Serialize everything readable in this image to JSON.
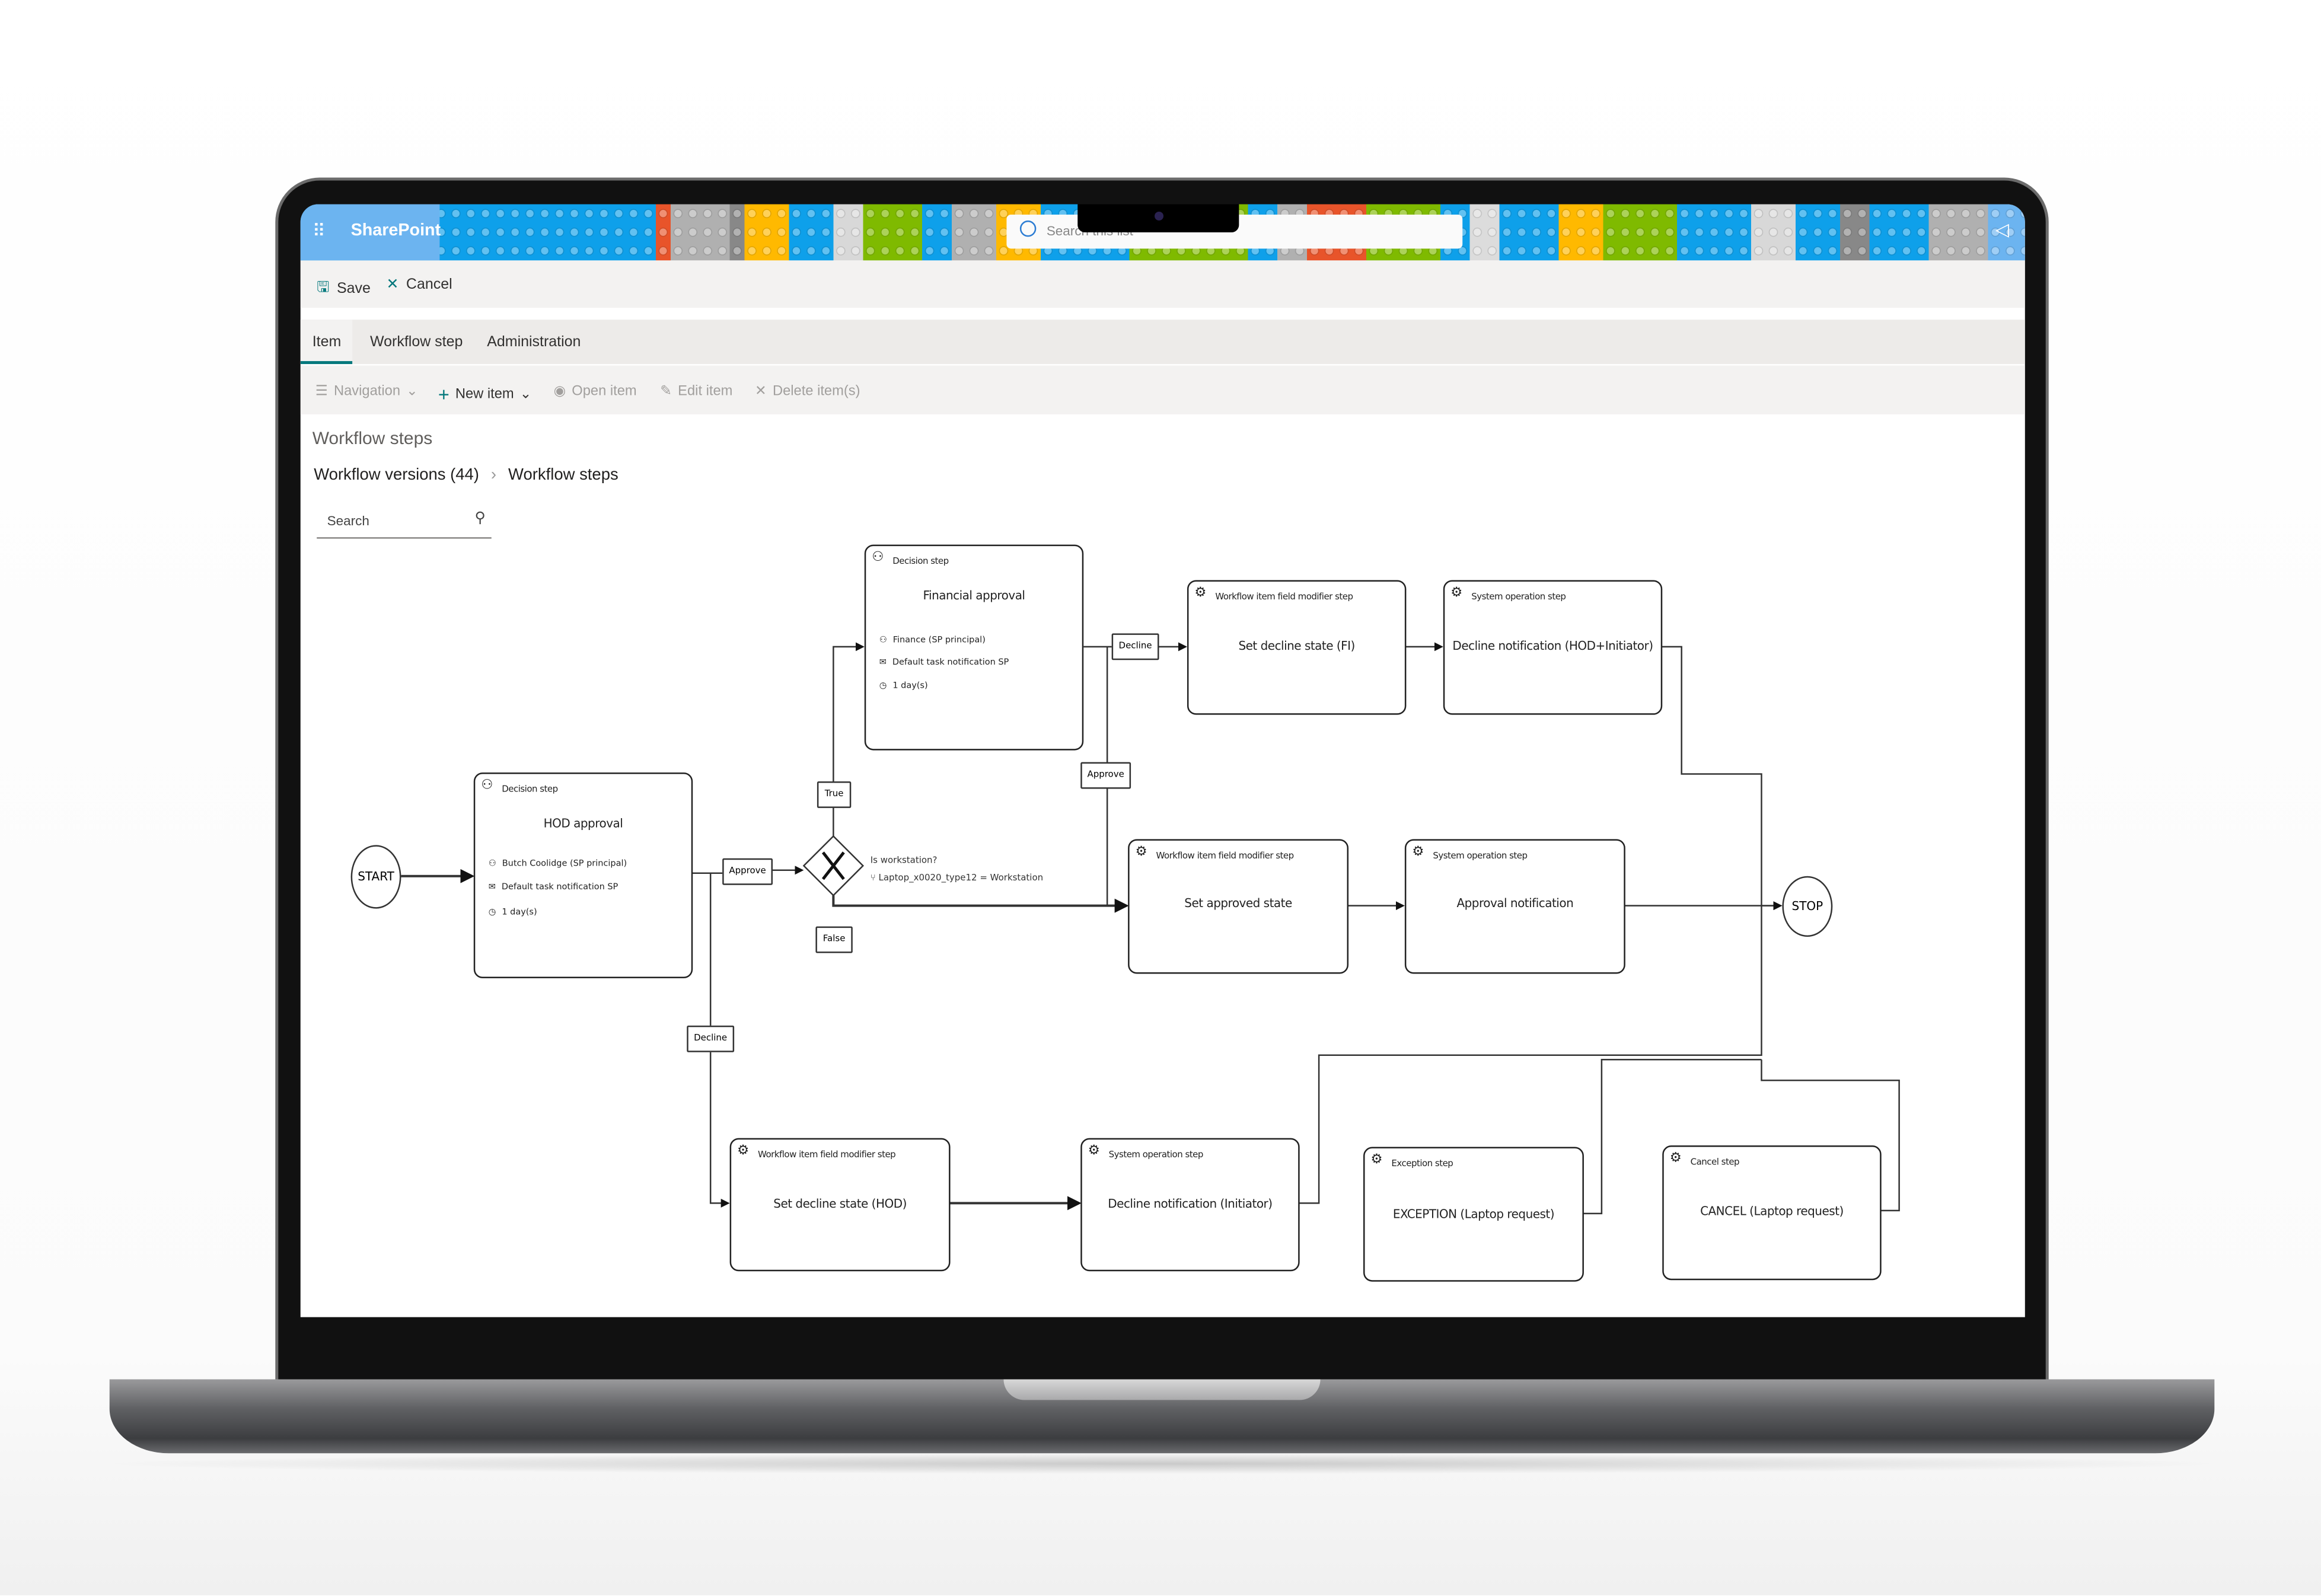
{
  "suite": {
    "brand": "SharePoint",
    "search_placeholder": "Search this list",
    "waffle_icon": "waffle-icon",
    "feedback_icon": "megaphone-icon"
  },
  "command_bar": {
    "save": "Save",
    "cancel": "Cancel"
  },
  "tabs": [
    {
      "label": "Item",
      "selected": true
    },
    {
      "label": "Workflow step"
    },
    {
      "label": "Administration"
    }
  ],
  "toolbar": {
    "navigation": "Navigation",
    "new_item": "New item",
    "open_item": "Open item",
    "edit_item": "Edit item",
    "delete_items": "Delete item(s)"
  },
  "page": {
    "title": "Workflow steps",
    "breadcrumb": [
      "Workflow versions (44)",
      "Workflow steps"
    ],
    "search_placeholder": "Search"
  },
  "colors": {
    "accent": "#03787c",
    "suite_brand": "#6cb4f0"
  },
  "diagram": {
    "start": "START",
    "stop": "STOP",
    "nodes": {
      "hod": {
        "type": "Decision step",
        "title": "HOD approval",
        "assignee": "Butch Coolidge (SP principal)",
        "notification": "Default task notification SP",
        "due": "1 day(s)"
      },
      "financial": {
        "type": "Decision step",
        "title": "Financial approval",
        "assignee": "Finance (SP principal)",
        "notification": "Default task notification SP",
        "due": "1 day(s)"
      },
      "set_decline_fi": {
        "type": "Workflow item field modifier step",
        "title": "Set decline state (FI)"
      },
      "decline_notif_hod": {
        "type": "System operation step",
        "title": "Decline notification (HOD+Initiator)"
      },
      "set_approved": {
        "type": "Workflow item field modifier step",
        "title": "Set approved state"
      },
      "approval_notif": {
        "type": "System operation step",
        "title": "Approval notification"
      },
      "set_decline_hod": {
        "type": "Workflow item field modifier step",
        "title": "Set decline state (HOD)"
      },
      "decline_notif_init": {
        "type": "System operation step",
        "title": "Decline notification (Initiator)"
      },
      "exception": {
        "type": "Exception step",
        "title": "EXCEPTION (Laptop request)"
      },
      "cancel": {
        "type": "Cancel step",
        "title": "CANCEL (Laptop request)"
      }
    },
    "gateway": {
      "question": "Is workstation?",
      "condition": "Laptop_x0020_type12 = Workstation"
    },
    "labels": {
      "hod_approve": "Approve",
      "hod_decline": "Decline",
      "true": "True",
      "false": "False",
      "fin_decline": "Decline",
      "fin_approve": "Approve"
    }
  }
}
